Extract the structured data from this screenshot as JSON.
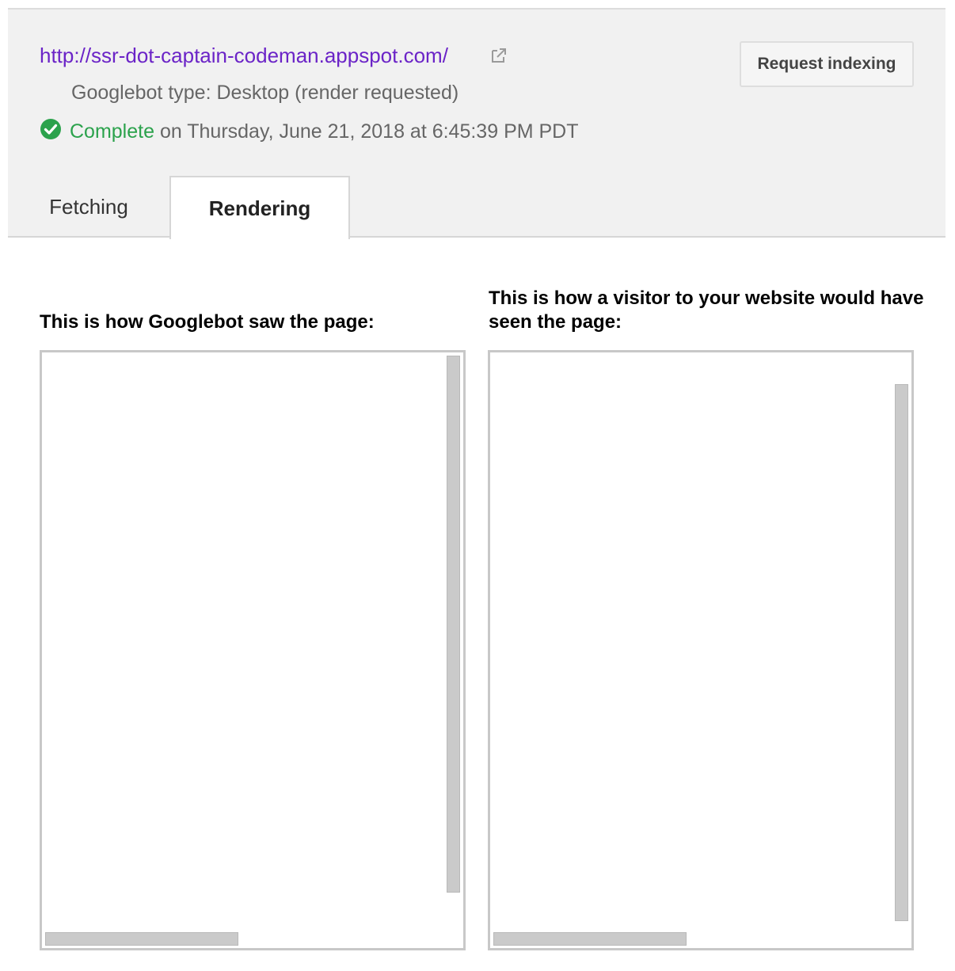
{
  "header": {
    "url": "http://ssr-dot-captain-codeman.appspot.com/",
    "external_link_icon": "external-link-icon",
    "googlebot_type": "Googlebot type: Desktop (render requested)",
    "status_icon": "check-circle-icon",
    "status_label": "Complete",
    "status_detail": " on Thursday, June 21, 2018 at 6:45:39 PM PDT",
    "request_indexing_label": "Request indexing"
  },
  "tabs": [
    {
      "label": "Fetching",
      "active": false
    },
    {
      "label": "Rendering",
      "active": true
    }
  ],
  "panels": {
    "googlebot_heading": "This is how Googlebot saw the page:",
    "visitor_heading": "This is how a visitor to your website would have seen the page:"
  },
  "colors": {
    "link": "#6b24c7",
    "status_complete": "#2ba24c",
    "header_background": "#f1f1f1"
  }
}
